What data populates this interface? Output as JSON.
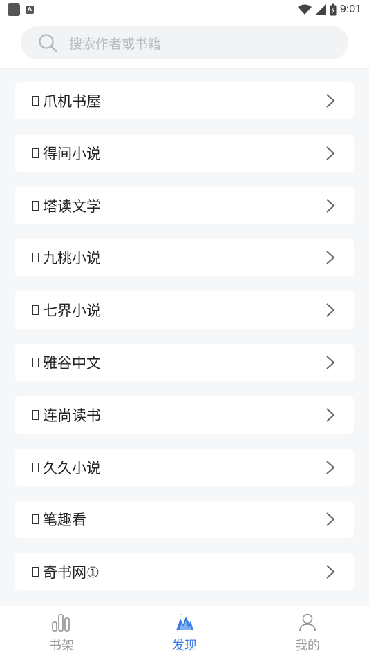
{
  "status_bar": {
    "time": "9:01",
    "left_icons": [
      "notification-square-icon",
      "a-badge-icon"
    ],
    "right_icons": [
      "wifi-icon",
      "signal-icon",
      "battery-icon"
    ]
  },
  "search": {
    "placeholder": "搜索作者或书籍"
  },
  "sources": [
    {
      "label": "爪机书屋"
    },
    {
      "label": "得间小说"
    },
    {
      "label": "塔读文学"
    },
    {
      "label": "九桃小说"
    },
    {
      "label": "七界小说"
    },
    {
      "label": "雅谷中文"
    },
    {
      "label": "连尚读书"
    },
    {
      "label": "久久小说"
    },
    {
      "label": "笔趣看"
    },
    {
      "label": "奇书网①"
    }
  ],
  "tabs": [
    {
      "label": "书架",
      "icon": "bookshelf-icon",
      "active": false
    },
    {
      "label": "发现",
      "icon": "discover-icon",
      "active": true
    },
    {
      "label": "我的",
      "icon": "profile-icon",
      "active": false
    }
  ],
  "colors": {
    "accent": "#3a7be0",
    "page_bg": "#f6f7f9",
    "inactive_tab": "#9a9a9a"
  }
}
